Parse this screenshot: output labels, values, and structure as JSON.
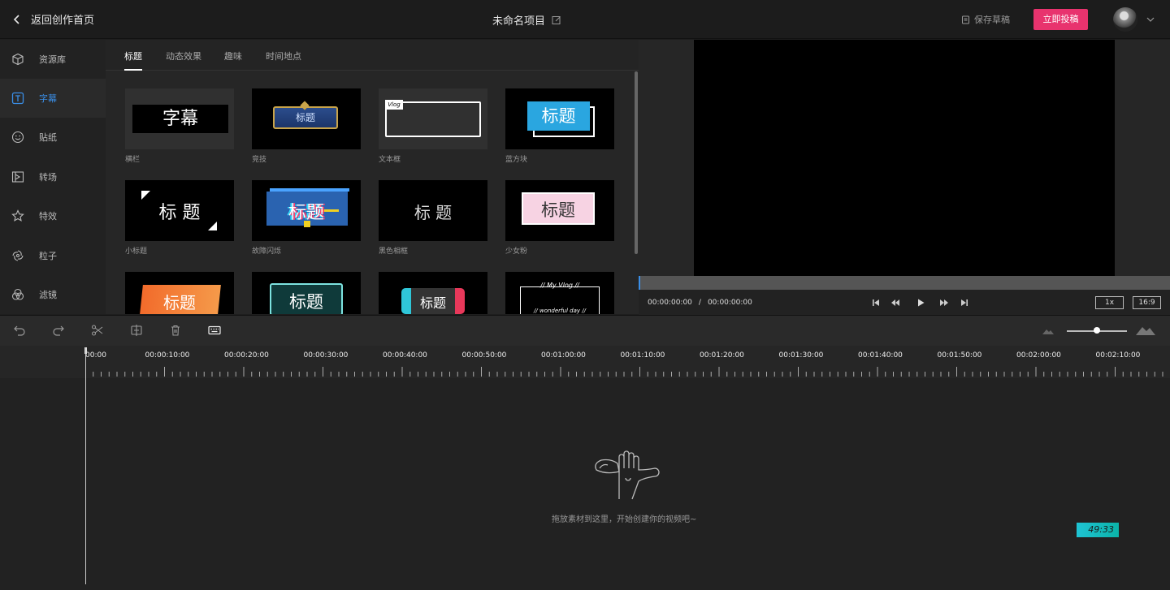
{
  "header": {
    "back_label": "返回创作首页",
    "project_title": "未命名项目",
    "save_label": "保存草稿",
    "publish_label": "立即投稿"
  },
  "nav": {
    "items": [
      {
        "label": "资源库",
        "icon": "cube-icon"
      },
      {
        "label": "字幕",
        "icon": "text-icon",
        "active": true
      },
      {
        "label": "贴纸",
        "icon": "smile-icon"
      },
      {
        "label": "转场",
        "icon": "transition-icon"
      },
      {
        "label": "特效",
        "icon": "star-icon"
      },
      {
        "label": "粒子",
        "icon": "particle-icon"
      },
      {
        "label": "滤镜",
        "icon": "filter-icon"
      }
    ]
  },
  "tabs": [
    {
      "label": "标题",
      "active": true
    },
    {
      "label": "动态效果"
    },
    {
      "label": "趣味"
    },
    {
      "label": "时间地点"
    }
  ],
  "templates": [
    {
      "label": "横栏",
      "thumb_text": "字幕"
    },
    {
      "label": "竞技",
      "thumb_text": "标题"
    },
    {
      "label": "文本框",
      "thumb_text": "Vlog"
    },
    {
      "label": "蓝方块",
      "thumb_text": "标题"
    },
    {
      "label": "小标题",
      "thumb_text": "标 题"
    },
    {
      "label": "故障闪烁",
      "thumb_text": "标题"
    },
    {
      "label": "黑色相框",
      "thumb_text": "标 题"
    },
    {
      "label": "少女粉",
      "thumb_text": "标题"
    },
    {
      "label": "",
      "thumb_text": "标题"
    },
    {
      "label": "",
      "thumb_text": "标题"
    },
    {
      "label": "",
      "thumb_text": "标题"
    },
    {
      "label": "",
      "thumb_text": "// My Vlog //",
      "thumb_text2": "// wonderful day //"
    }
  ],
  "player": {
    "current_time": "00:00:00:00",
    "separator": "/",
    "total_time": "00:00:00:00",
    "speed": "1x",
    "ratio": "16:9"
  },
  "timeline": {
    "ticks": [
      "00:00",
      "00:00:10:00",
      "00:00:20:00",
      "00:00:30:00",
      "00:00:40:00",
      "00:00:50:00",
      "00:01:00:00",
      "00:01:10:00",
      "00:01:20:00",
      "00:01:30:00",
      "00:01:40:00",
      "00:01:50:00",
      "00:02:00:00",
      "00:02:10:00"
    ],
    "empty_hint": "拖放素材到这里，开始创建你的视频吧~",
    "badge": "49:33"
  },
  "colors": {
    "accent": "#3a8ee6",
    "publish": "#e8336e",
    "badge": "#1fc4d4"
  }
}
